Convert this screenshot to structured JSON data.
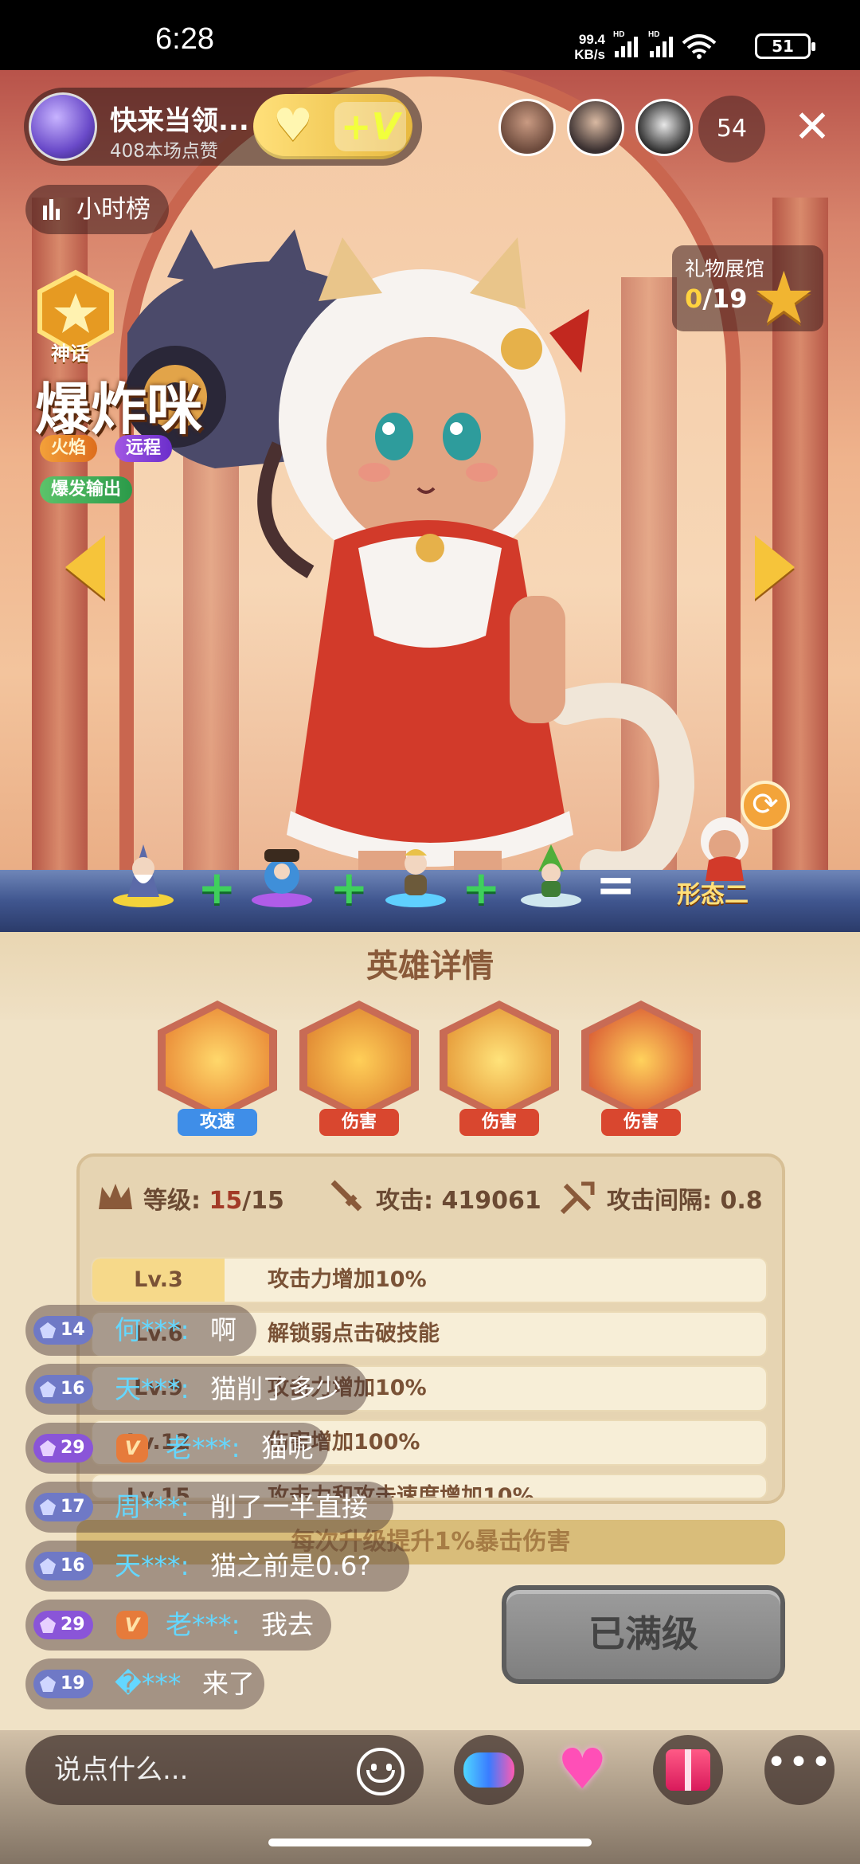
{
  "status_bar": {
    "time": "6:28",
    "net_speed_value": "99.4",
    "net_speed_unit": "KB/s",
    "battery": "51"
  },
  "host": {
    "name": "快来当领...",
    "likes": "408本场点赞"
  },
  "follow": {
    "heart_icon": "heart-icon",
    "vip_label": "+V"
  },
  "viewers": {
    "count": "54"
  },
  "rank": {
    "label": "小时榜"
  },
  "gift_hall": {
    "title": "礼物展馆",
    "collected": "0",
    "total": "/19"
  },
  "hero": {
    "rarity": "神话",
    "name": "爆炸咪",
    "tags": [
      "火焰",
      "远程"
    ],
    "role": "爆发输出"
  },
  "combo": {
    "result": "形态二"
  },
  "panel": {
    "title": "英雄详情",
    "skills": [
      {
        "label": "攻速",
        "color": "#3f8ee8"
      },
      {
        "label": "伤害",
        "color": "#d9472f"
      },
      {
        "label": "伤害",
        "color": "#d9472f"
      },
      {
        "label": "伤害",
        "color": "#d9472f"
      }
    ],
    "stats": {
      "level_label": "等级:",
      "level_value": "15",
      "level_max": "/15",
      "attack_label": "攻击:",
      "attack_value": "419061",
      "interval_label": "攻击间隔:",
      "interval_value": "0.8"
    },
    "levels": [
      {
        "lv": "Lv.3",
        "desc": "攻击力增加10%"
      },
      {
        "lv": "Lv.6",
        "desc": "解锁弱点击破技能"
      },
      {
        "lv": "Lv.9",
        "desc": "攻击力增加10%"
      },
      {
        "lv": "Lv.12",
        "desc": "伤害增加100%"
      },
      {
        "lv": "Lv.15",
        "desc": "攻击力和攻击速度增加10%"
      }
    ],
    "tip": "每次升级提升1%暴击伤害",
    "max_button": "已满级"
  },
  "chat": [
    {
      "level": "14",
      "tier": "blue",
      "vip": false,
      "user": "何***:",
      "text": "啊"
    },
    {
      "level": "16",
      "tier": "blue",
      "vip": false,
      "user": "天***:",
      "text": "猫削了多少"
    },
    {
      "level": "29",
      "tier": "purple",
      "vip": true,
      "user": "老***:",
      "text": "猫呢"
    },
    {
      "level": "17",
      "tier": "blue",
      "vip": false,
      "user": "周***:",
      "text": "削了一半直接"
    },
    {
      "level": "16",
      "tier": "blue",
      "vip": false,
      "user": "天***:",
      "text": "猫之前是0.6?"
    },
    {
      "level": "29",
      "tier": "purple",
      "vip": true,
      "user": "老***:",
      "text": "我去"
    },
    {
      "level": "19",
      "tier": "blue",
      "vip": false,
      "user": "�***",
      "text": "来了"
    }
  ],
  "bottom": {
    "input_placeholder": "说点什么...",
    "more_label": "•••"
  }
}
